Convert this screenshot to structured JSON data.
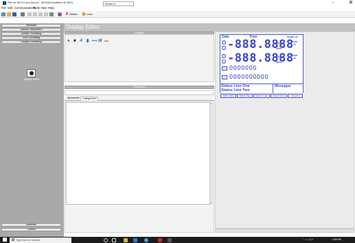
{
  "window": {
    "title": "Rev for 820-H and Nexus - [20160d Modified SP 820]",
    "minimize": "–",
    "close": "⊠"
  },
  "menu": [
    "File",
    "Edit",
    "Communications",
    "Tools",
    "View",
    "Help"
  ],
  "toolbar": {
    "delete_label": "Delete",
    "lock_label": "Lock",
    "screen_value": "Screen 1"
  },
  "nav": {
    "items": [
      "Hardware",
      "System Parameters",
      "Stream Formatting",
      "Print Formatting",
      "Display Formatting"
    ],
    "active_label": "Display Editor",
    "bottom_items": [
      "Database",
      "Custom"
    ]
  },
  "editor": {
    "title": "Display Editor",
    "widgets_header": "Widgets",
    "properties_header": "Properties",
    "tabs": [
      "Alphabetic",
      "Categorized"
    ]
  },
  "widget_icons": [
    "pointer-icon",
    "rectangle-icon",
    "text-A-icon",
    "bar-icon",
    "line-icon",
    "w-icon",
    "image-icon"
  ],
  "lcd": {
    "date_label": "Date",
    "time_label": "Time",
    "scale_label": "Scale #s",
    "row1_digits": "-888.8888",
    "row2_digits": "-888.8888",
    "mode_label": "Mode",
    "units_label": "Units",
    "scale1_label": "Scale\n#1",
    "scale2_label": "Scale\n#2",
    "gross_label": "GROSS",
    "circles1": "OOOOOOO",
    "circles2": "OOOOOOOOOO",
    "status_line1": "Status Line One",
    "status_line2": "Status Line Two",
    "messages_label": "Messages",
    "buttons": [
      "Batch Start",
      "Batch Stop",
      "Batch Pause",
      "Batch Reset",
      "Setpoint"
    ]
  },
  "taskbar": {
    "search_placeholder": "Type here to search",
    "clock": "4:58 PM"
  },
  "colors": {
    "lcd_blue": "#3a47c4",
    "nav_gray": "#a9a9a9",
    "taskbar": "#1c1c1c"
  }
}
